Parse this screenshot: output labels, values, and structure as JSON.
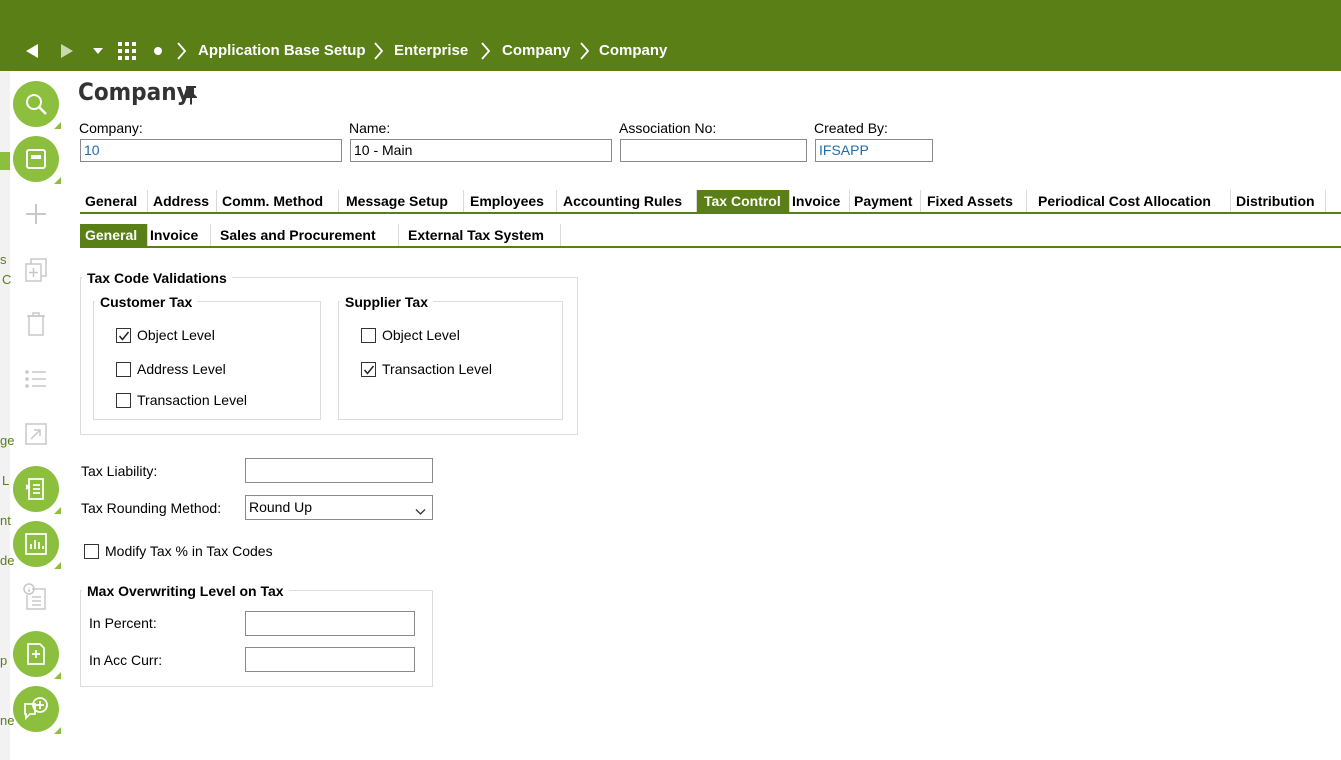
{
  "breadcrumb": [
    "Application Base Setup",
    "Enterprise",
    "Company",
    "Company"
  ],
  "page_title": "Company",
  "fields": {
    "company": {
      "label": "Company:",
      "value": "10"
    },
    "name": {
      "label": "Name:",
      "value": "10 - Main"
    },
    "association_no": {
      "label": "Association No:",
      "value": ""
    },
    "created_by": {
      "label": "Created By:",
      "value": "IFSAPP"
    }
  },
  "tabs": [
    "General",
    "Address",
    "Comm. Method",
    "Message Setup",
    "Employees",
    "Accounting Rules",
    "Tax Control",
    "Invoice",
    "Payment",
    "Fixed Assets",
    "Periodical Cost Allocation",
    "Distribution"
  ],
  "active_tab": "Tax Control",
  "subtabs": [
    "General",
    "Invoice",
    "Sales and Procurement",
    "External Tax System"
  ],
  "active_subtab": "General",
  "tax_code_validations": {
    "title": "Tax Code Validations",
    "customer_tax": {
      "title": "Customer Tax",
      "object_level": {
        "label": "Object Level",
        "checked": true
      },
      "address_level": {
        "label": "Address Level",
        "checked": false
      },
      "transaction_level": {
        "label": "Transaction Level",
        "checked": false
      }
    },
    "supplier_tax": {
      "title": "Supplier Tax",
      "object_level": {
        "label": "Object Level",
        "checked": false
      },
      "transaction_level": {
        "label": "Transaction Level",
        "checked": true
      }
    }
  },
  "tax_liability": {
    "label": "Tax Liability:",
    "value": ""
  },
  "tax_rounding_method": {
    "label": "Tax Rounding Method:",
    "value": "Round Up"
  },
  "modify_tax": {
    "label": "Modify Tax % in Tax Codes",
    "checked": false
  },
  "max_overwriting": {
    "title": "Max Overwriting Level on Tax",
    "in_percent": {
      "label": "In Percent:",
      "value": ""
    },
    "in_acc_curr": {
      "label": "In Acc Curr:",
      "value": ""
    }
  },
  "side_fragments": [
    "s",
    "C",
    "ge",
    "L",
    "nt",
    "de",
    "p",
    "ne"
  ],
  "colors": {
    "header": "#5a7f16",
    "accent": "#8cbf3e",
    "link": "#1d6ea8"
  }
}
